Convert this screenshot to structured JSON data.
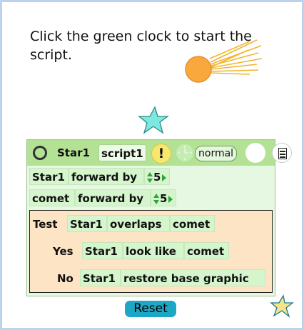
{
  "instructions": "Click the green clock to start the script.",
  "script": {
    "sprite_name": "Star1",
    "script_name": "script1",
    "alert_label": "!",
    "mode_label": "normal",
    "row1": {
      "actor": "Star1",
      "action": "forward by",
      "value": "5"
    },
    "row2": {
      "actor": "comet",
      "action": "forward by",
      "value": "5"
    },
    "test": {
      "test_label": "Test",
      "actor": "Star1",
      "predicate": "overlaps",
      "target": "comet",
      "yes_label": "Yes",
      "yes_actor": "Star1",
      "yes_action": "look like",
      "yes_target": "comet",
      "no_label": "No",
      "no_actor": "Star1",
      "no_action": "restore base graphic"
    }
  },
  "reset_label": "Reset",
  "icons": [
    "comet-icon",
    "star-icon",
    "clock-icon",
    "menu-circle-icon",
    "sheet-icon"
  ],
  "colors": {
    "header": "#b3e295",
    "tile": "#d5f5cc",
    "test_box": "#fde4c4",
    "reset": "#1ea7c4",
    "star": "#7de8e0"
  }
}
